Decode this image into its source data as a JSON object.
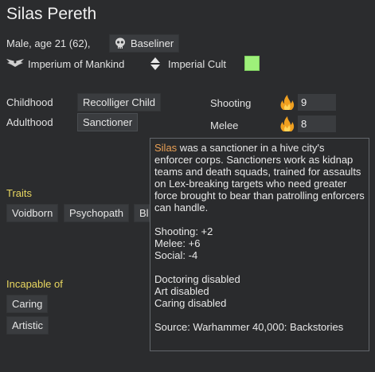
{
  "pawn": {
    "name": "Silas Pereth",
    "summary": "Male, age 21 (62),",
    "xenotype": "Baseliner",
    "faction": "Imperium of Mankind",
    "ideology": "Imperial Cult",
    "ideology_color": "#9ef07a"
  },
  "backstory": {
    "childhood_label": "Childhood",
    "childhood_value": "Recolliger Child",
    "adulthood_label": "Adulthood",
    "adulthood_value": "Sanctioner"
  },
  "skills": [
    {
      "label": "Shooting",
      "value": "9",
      "passion_icon": "flame-icon"
    },
    {
      "label": "Melee",
      "value": "8",
      "passion_icon": "flame-icon"
    }
  ],
  "traits": {
    "heading": "Traits",
    "items": [
      "Voidborn",
      "Psychopath",
      "Bl"
    ]
  },
  "incapable": {
    "heading": "Incapable of",
    "items": [
      "Caring",
      "Artistic"
    ]
  },
  "tooltip": {
    "name": "Silas",
    "description": " was a sanctioner in a hive city's enforcer corps. Sanctioners work as kidnap teams and death squads, trained for assaults on Lex-breaking targets who need greater force brought to bear than patrolling enforcers can handle.",
    "stats": [
      "Shooting: +2",
      "Melee: +6",
      "Social: -4"
    ],
    "disabled": [
      "Doctoring disabled",
      "Art disabled",
      "Caring disabled"
    ],
    "source": "Source: Warhammer 40,000: Backstories"
  }
}
